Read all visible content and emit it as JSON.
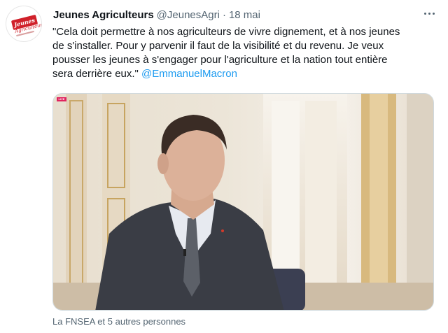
{
  "tweet": {
    "author_name": "Jeunes Agriculteurs",
    "handle": "@JeunesAgri",
    "separator": "·",
    "date": "18 mai",
    "text_before_mention": "\"Cela doit permettre à nos agriculteurs de vivre dignement, et à nos jeunes\nde s'installer. Pour y parvenir il faut de la visibilité et du revenu. Je veux\npousser les jeunes à s'engager pour l'agriculture et la nation tout entière\nsera derrière eux.\" ",
    "mention": "@EmmanuelMacron",
    "liked_by": "La FNSEA et 5 autres personnes"
  },
  "avatar": {
    "logo_text": "Jeunes",
    "logo_subtext": "Agriculteurs"
  },
  "media": {
    "badge": "LIVE"
  },
  "colors": {
    "accent": "#1d9bf0",
    "brand_red": "#d0202a",
    "secondary_text": "#536471"
  },
  "icons": {
    "more": "more-horizontal-icon"
  }
}
